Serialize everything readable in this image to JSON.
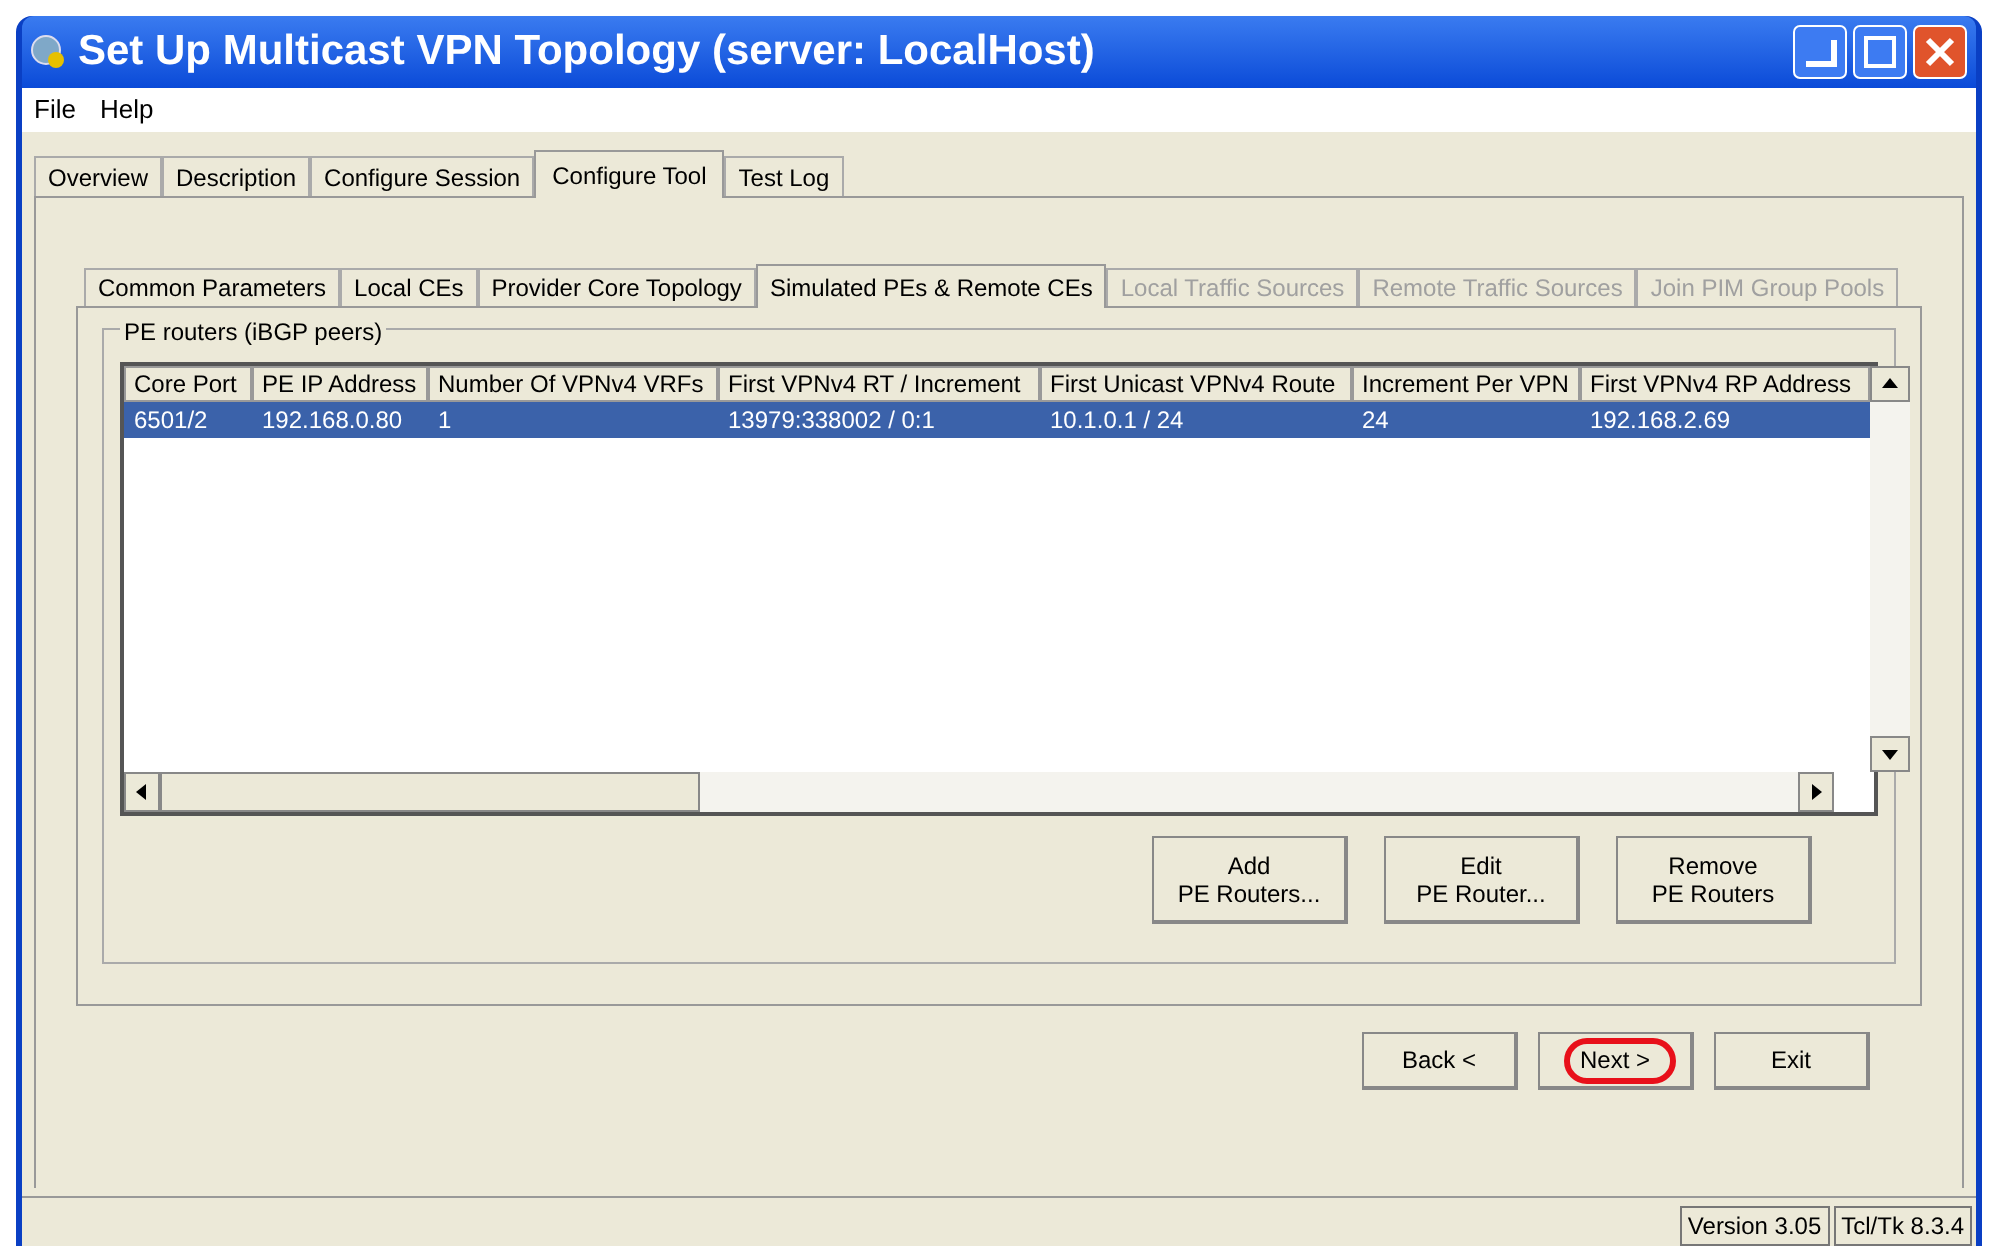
{
  "window": {
    "title": "Set Up Multicast VPN Topology (server: LocalHost)"
  },
  "menu": [
    "File",
    "Help"
  ],
  "tabs": [
    {
      "label": "Overview",
      "selected": false
    },
    {
      "label": "Description",
      "selected": false
    },
    {
      "label": "Configure Session",
      "selected": false
    },
    {
      "label": "Configure Tool",
      "selected": true
    },
    {
      "label": "Test Log",
      "selected": false
    }
  ],
  "subtabs": [
    {
      "label": "Common Parameters",
      "selected": false,
      "disabled": false
    },
    {
      "label": "Local CEs",
      "selected": false,
      "disabled": false
    },
    {
      "label": "Provider Core Topology",
      "selected": false,
      "disabled": false
    },
    {
      "label": "Simulated PEs & Remote CEs",
      "selected": true,
      "disabled": false
    },
    {
      "label": "Local Traffic Sources",
      "selected": false,
      "disabled": true
    },
    {
      "label": "Remote Traffic Sources",
      "selected": false,
      "disabled": true
    },
    {
      "label": "Join PIM Group Pools",
      "selected": false,
      "disabled": true
    }
  ],
  "group": {
    "title": "PE routers (iBGP peers)",
    "table": {
      "columns": [
        "Core Port",
        "PE IP Address",
        "Number Of VPNv4 VRFs",
        "First VPNv4 RT / Increment",
        "First Unicast VPNv4 Route",
        "Increment Per VPN",
        "First VPNv4 RP Address"
      ],
      "rows": [
        {
          "selected": true,
          "cells": [
            "6501/2",
            "192.168.0.80",
            "1",
            "13979:338002 / 0:1",
            "10.1.0.1 / 24",
            "24",
            "192.168.2.69"
          ]
        }
      ]
    },
    "buttons": [
      [
        "Add",
        "PE Routers..."
      ],
      [
        "Edit",
        "PE Router..."
      ],
      [
        "Remove",
        "PE Routers"
      ]
    ]
  },
  "nav_buttons": [
    {
      "label": "Back <",
      "circled": false
    },
    {
      "label": "Next >",
      "circled": true
    },
    {
      "label": "Exit",
      "circled": false
    }
  ],
  "status_bar": [
    "Version 3.05",
    "Tcl/Tk 8.3.4"
  ]
}
